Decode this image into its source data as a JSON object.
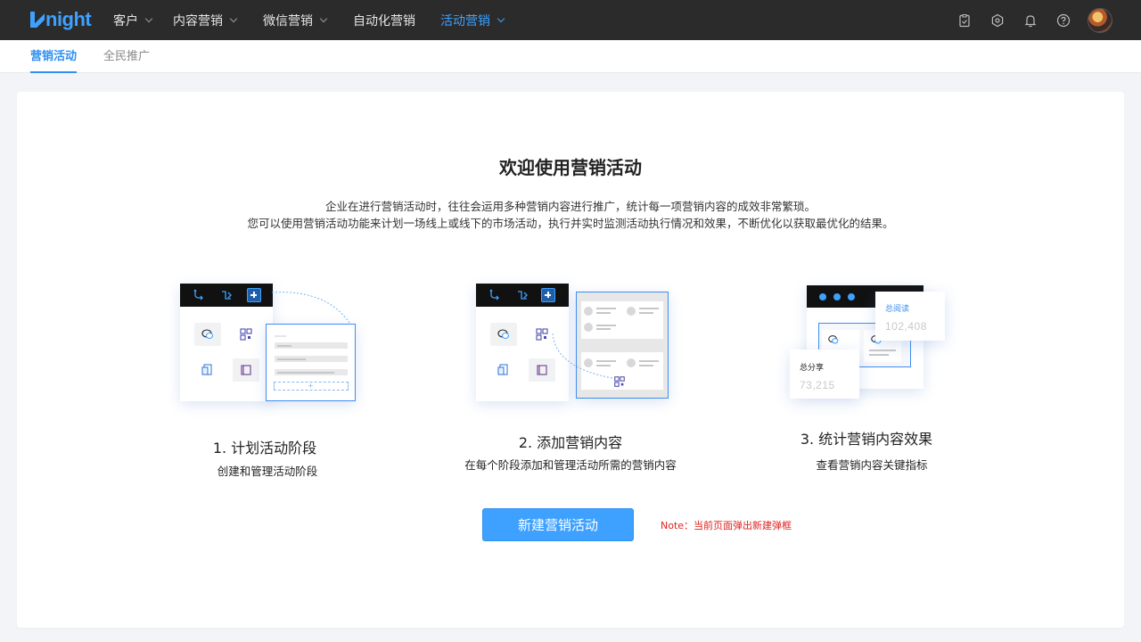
{
  "app": {
    "logo": "Knight"
  },
  "topnav": {
    "items": [
      {
        "label": "客户",
        "has_dropdown": true
      },
      {
        "label": "内容营销",
        "has_dropdown": true
      },
      {
        "label": "微信营销",
        "has_dropdown": true
      },
      {
        "label": "自动化营销",
        "has_dropdown": false
      },
      {
        "label": "活动营销",
        "has_dropdown": true,
        "active": true
      }
    ],
    "icons": [
      "clipboard-check-icon",
      "settings-icon",
      "bell-icon",
      "help-icon",
      "avatar"
    ]
  },
  "subnav": {
    "tabs": [
      {
        "label": "营销活动",
        "active": true
      },
      {
        "label": "全民推广",
        "active": false
      }
    ]
  },
  "welcome": {
    "title": "欢迎使用营销活动",
    "line1": "企业在进行营销活动时，往往会运用多种营销内容进行推广，统计每一项营销内容的成效非常繁琐。",
    "line2": "您可以使用营销活动功能来计划一场线上或线下的市场活动，执行并实时监测活动执行情况和效果，不断优化以获取最优化的结果。"
  },
  "steps": [
    {
      "title": "1. 计划活动阶段",
      "subtitle": "创建和管理活动阶段"
    },
    {
      "title": "2. 添加营销内容",
      "subtitle": "在每个阶段添加和管理活动所需的营销内容"
    },
    {
      "title": "3. 统计营销内容效果",
      "subtitle": "查看营销内容关键指标"
    }
  ],
  "stats": {
    "reads_label": "总阅读",
    "reads_value": "102,408",
    "shares_label": "总分享",
    "shares_value": "73,215"
  },
  "cta": {
    "label": "新建营销活动"
  },
  "note": "Note：当前页面弹出新建弹框",
  "colors": {
    "accent": "#3ea1ff",
    "nav_bg": "#2b2b2b",
    "note": "#e02020"
  }
}
